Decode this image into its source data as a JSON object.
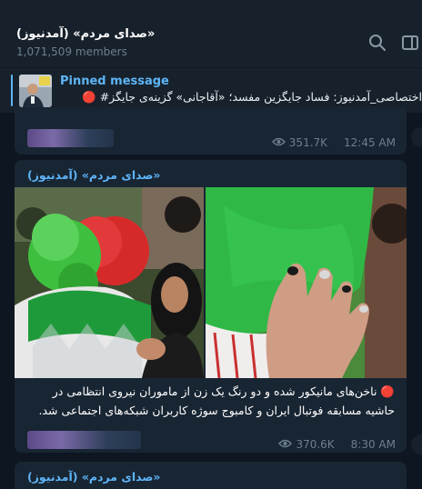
{
  "header": {
    "channel_title": "(صدای مردم» (آمدنیوز»",
    "members": "1,071,509 members",
    "icons": [
      "search-icon",
      "sidebar-toggle-icon"
    ]
  },
  "pinned": {
    "label": "Pinned message",
    "text": "اختصاصی_آمدنیوز: فساد جایگزین مفسد؛ «آقاجانی» گزینه‌ی جایگز# 🔴"
  },
  "messages": [
    {
      "views": "351.7K",
      "time": "12:45 AM"
    },
    {
      "sender": "(صدای مردم» (آمدنیوز»",
      "caption": "🔴 ناخن‌های مانیکور شده و دو رنگ یک زن از ماموران نیروی انتظامی در حاشیه مسابقه فوتبال ایران و کامبوج سوژه کاربران شبکه‌های اجتماعی شد.",
      "views": "370.6K",
      "time": "8:30 AM"
    },
    {
      "sender": "(صدای مردم» (آمدنیوز»"
    }
  ],
  "colors": {
    "background": "#0e1621",
    "header": "#17212b",
    "bubble": "#182533",
    "accent": "#5eb5f7",
    "muted": "#6d7f8f"
  }
}
